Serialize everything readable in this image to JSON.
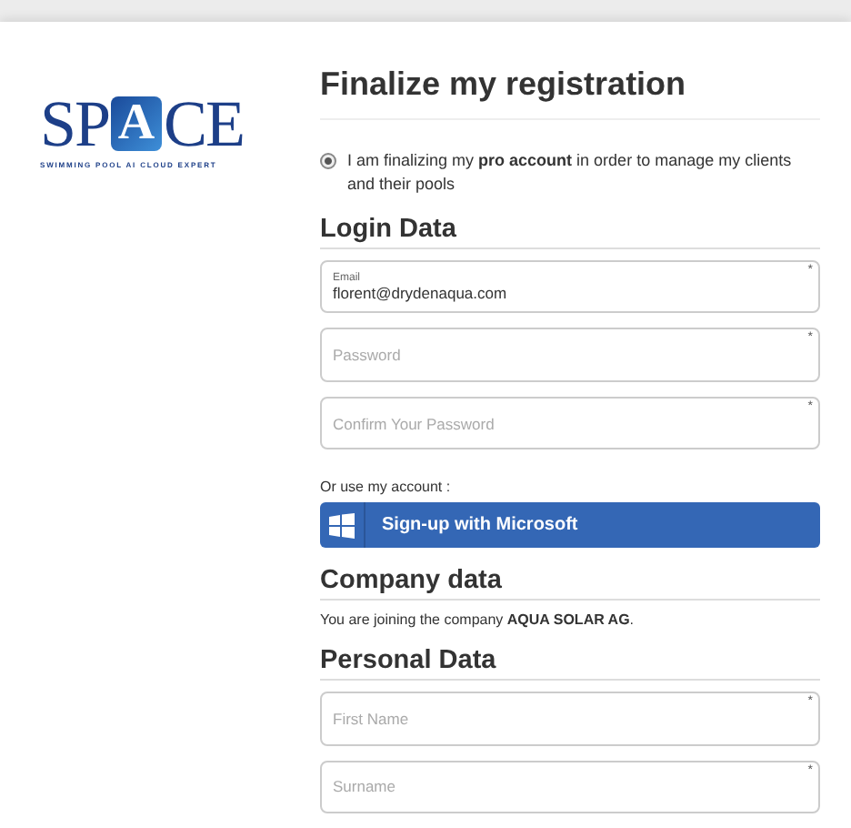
{
  "logo": {
    "left": "SP",
    "emblem": "A",
    "right": "CE",
    "tagline": "SWIMMING POOL AI CLOUD EXPERT"
  },
  "title": "Finalize my registration",
  "account_option": {
    "selected": true,
    "text": "I am finalizing my **pro account** in order to manage my clients and their pools"
  },
  "login_section": {
    "heading": "Login Data",
    "fields": [
      {
        "label": "Email",
        "value": "florent@drydenaqua.com",
        "required_mark": "*"
      },
      {
        "placeholder": "Password",
        "required_mark": "*"
      },
      {
        "placeholder": "Confirm Your Password",
        "required_mark": "*"
      }
    ]
  },
  "alt_login": {
    "caption": "Or use my account :",
    "button": "Sign-up with Microsoft"
  },
  "company_section": {
    "heading": "Company data",
    "text": "You are joining the company **AQUA SOLAR AG**."
  },
  "personal_section": {
    "heading": "Personal Data",
    "fields": [
      {
        "placeholder": "First Name",
        "required_mark": "*"
      },
      {
        "placeholder": "Surname",
        "required_mark": "*"
      }
    ]
  }
}
